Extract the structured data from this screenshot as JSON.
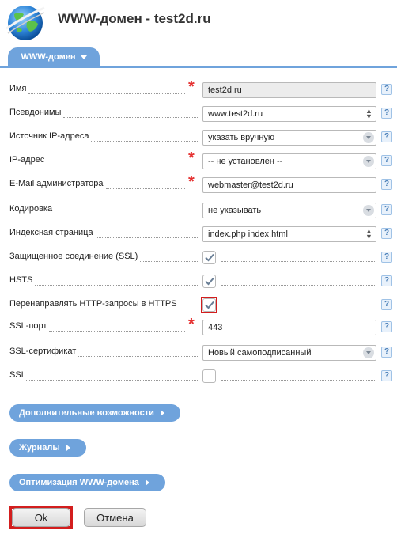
{
  "header": {
    "title": "WWW-домен - test2d.ru",
    "icon": "globe-icon"
  },
  "tab": {
    "label": "WWW-домен",
    "color": "#6fa3dc"
  },
  "form": {
    "rows": [
      {
        "label": "Имя",
        "value": "test2d.ru",
        "required": true,
        "kind": "text-readonly"
      },
      {
        "label": "Псевдонимы",
        "value": "www.test2d.ru",
        "required": false,
        "kind": "multiline"
      },
      {
        "label": "Источник IP-адреса",
        "value": "указать вручную",
        "required": false,
        "kind": "select"
      },
      {
        "label": "IP-адрес",
        "value": "-- не установлен --",
        "required": true,
        "kind": "select"
      },
      {
        "label": "E-Mail администратора",
        "value": "webmaster@test2d.ru",
        "required": true,
        "kind": "text"
      },
      {
        "label": "Кодировка",
        "value": "не указывать",
        "required": false,
        "kind": "select"
      },
      {
        "label": "Индексная страница",
        "value": "index.php index.html",
        "required": false,
        "kind": "multiline"
      },
      {
        "label": "Защищенное соединение (SSL)",
        "checked": true,
        "kind": "checkbox"
      },
      {
        "label": "HSTS",
        "checked": true,
        "kind": "checkbox"
      },
      {
        "label": "Перенаправлять HTTP-запросы в HTTPS",
        "checked": true,
        "kind": "checkbox",
        "highlighted": true
      },
      {
        "label": "SSL-порт",
        "value": "443",
        "required": true,
        "kind": "text"
      },
      {
        "label": "SSL-сертификат",
        "value": "Новый самоподписанный",
        "required": false,
        "kind": "select"
      },
      {
        "label": "SSI",
        "checked": false,
        "kind": "checkbox"
      }
    ],
    "help_label": "?"
  },
  "sections": [
    {
      "label": "Дополнительные возможности"
    },
    {
      "label": "Журналы"
    },
    {
      "label": "Оптимизация WWW-домена"
    }
  ],
  "buttons": {
    "ok": "Ok",
    "cancel": "Отмена"
  },
  "colors": {
    "accent": "#6fa3dc",
    "required": "#e53030",
    "highlight": "#d31e1e"
  }
}
